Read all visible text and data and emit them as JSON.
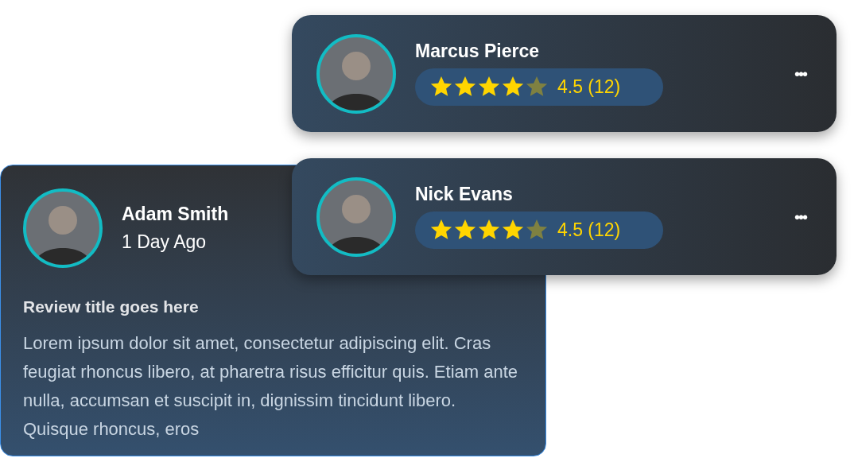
{
  "review": {
    "name": "Adam Smith",
    "time": "1 Day Ago",
    "title": "Review title goes here",
    "body": "Lorem ipsum dolor sit amet, consectetur adipiscing elit. Cras feugiat rhoncus libero, at pharetra risus efficitur quis. Etiam ante nulla, accumsan et suscipit in, dignissim tincidunt libero. Quisque rhoncus, eros"
  },
  "profiles": [
    {
      "name": "Marcus Pierce",
      "stars": 4,
      "rating": "4.5 (12)",
      "menu": "•••"
    },
    {
      "name": "Nick Evans",
      "stars": 4,
      "rating": "4.5 (12)",
      "menu": "•••"
    }
  ]
}
